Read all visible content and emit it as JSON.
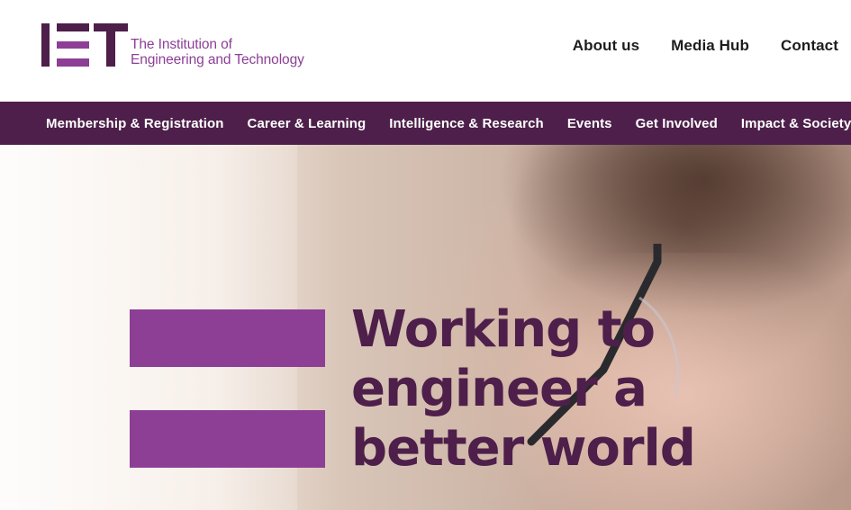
{
  "brand": {
    "name_line1": "The Institution of",
    "name_line2": "Engineering and Technology",
    "primary_color": "#8d3f96",
    "dark_color": "#4d1f4a"
  },
  "top_nav": {
    "items": [
      {
        "label": "About us"
      },
      {
        "label": "Media Hub"
      },
      {
        "label": "Contact"
      }
    ]
  },
  "main_nav": {
    "items": [
      {
        "label": "Membership & Registration"
      },
      {
        "label": "Career & Learning"
      },
      {
        "label": "Intelligence & Research"
      },
      {
        "label": "Events"
      },
      {
        "label": "Get Involved"
      },
      {
        "label": "Impact & Society"
      }
    ]
  },
  "hero": {
    "headline_line1": "Working to",
    "headline_line2": "engineer a",
    "headline_line3": "better world"
  }
}
